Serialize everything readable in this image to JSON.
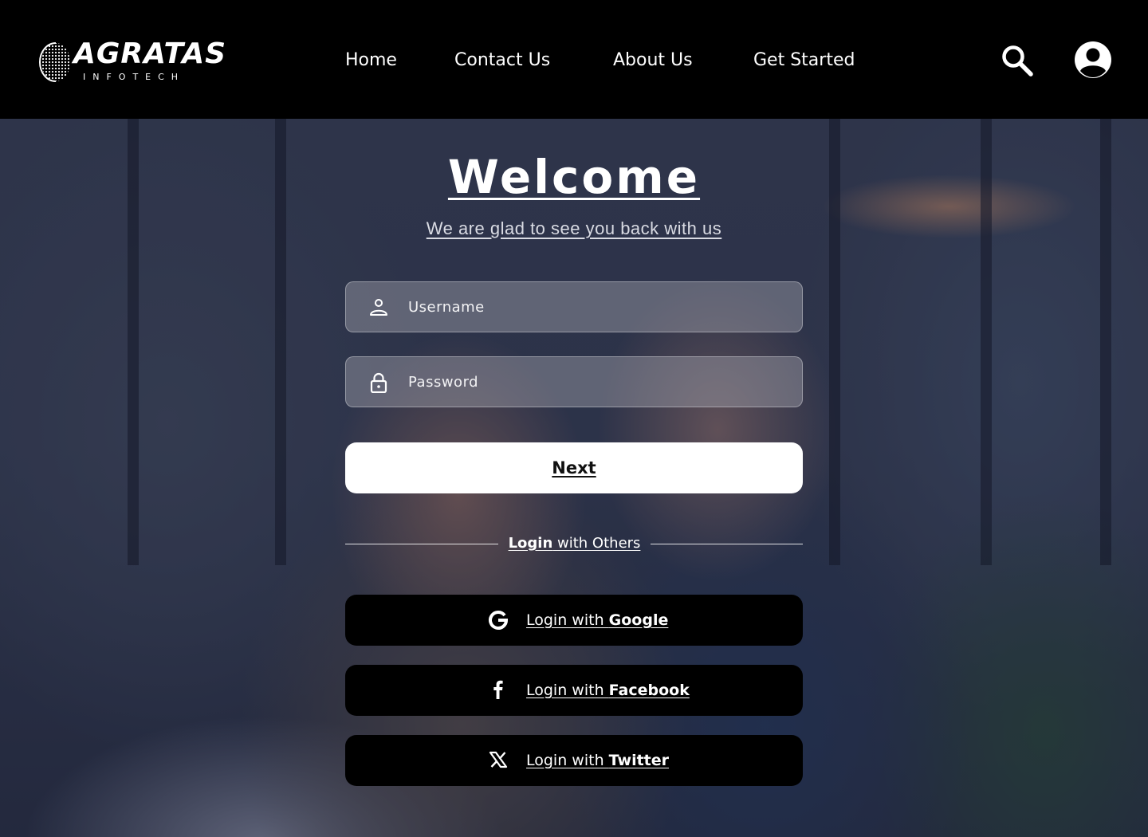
{
  "brand": {
    "name": "AGRATAS",
    "tagline": "INFOTECH"
  },
  "nav": {
    "items": [
      {
        "label": "Home"
      },
      {
        "label": "Contact Us"
      },
      {
        "label": "About Us"
      },
      {
        "label": "Get Started"
      }
    ]
  },
  "header_icons": {
    "search": "search-icon",
    "account": "account-icon"
  },
  "login": {
    "title": "Welcome",
    "subtitle": "We are glad to see you back with us",
    "username": {
      "placeholder": "Username",
      "value": "",
      "icon": "user-icon"
    },
    "password": {
      "placeholder": "Password",
      "value": "",
      "icon": "lock-icon"
    },
    "next_label": "Next",
    "divider": {
      "bold": "Login",
      "rest": " with Others"
    },
    "social": [
      {
        "prefix": "Login with ",
        "provider": "Google",
        "icon": "google-icon"
      },
      {
        "prefix": "Login with ",
        "provider": "Facebook",
        "icon": "facebook-icon"
      },
      {
        "prefix": "Login with ",
        "provider": "Twitter",
        "icon": "x-twitter-icon"
      }
    ]
  },
  "colors": {
    "header_bg": "#000000",
    "primary_button_bg": "#ffffff",
    "social_button_bg": "#000000",
    "text": "#ffffff"
  }
}
